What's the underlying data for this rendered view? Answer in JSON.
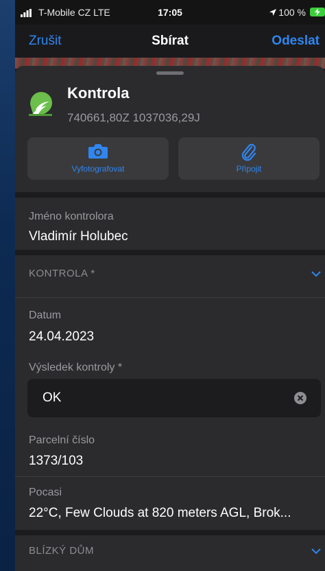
{
  "status_bar": {
    "carrier": "T-Mobile CZ  LTE",
    "time": "17:05",
    "battery": "100 %"
  },
  "nav": {
    "cancel_label": "Zrušit",
    "title": "Sbírat",
    "send_label": "Odeslat"
  },
  "feature": {
    "title": "Kontrola",
    "coordinates": "740661,80Z 1037036,29J",
    "icon": "feature-layer-icon"
  },
  "actions": [
    {
      "label": "Vyfotografovat",
      "icon": "camera-icon"
    },
    {
      "label": "Připojit",
      "icon": "paperclip-icon"
    }
  ],
  "fields": {
    "inspector": {
      "label": "Jméno kontrolora",
      "value": "Vladimír Holubec"
    },
    "section_kontrola": {
      "title": "KONTROLA *"
    },
    "date": {
      "label": "Datum",
      "value": "24.04.2023"
    },
    "result": {
      "label": "Výsledek kontroly *",
      "value": "OK"
    },
    "parcel": {
      "label": "Parcelní číslo",
      "value": "1373/103"
    },
    "weather": {
      "label": "Pocasi",
      "value": "22°C, Few Clouds at 820 meters AGL, Brok..."
    },
    "section_house": {
      "title": "BLÍZKÝ DŮM"
    }
  },
  "colors": {
    "accent": "#2f86f0",
    "background": "#2b2b2d",
    "battery": "#3ccf3c"
  }
}
